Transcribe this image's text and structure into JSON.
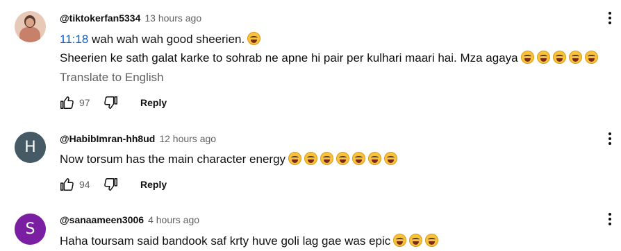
{
  "comments": [
    {
      "handle": "@tiktokerfan5334",
      "time": "13 hours ago",
      "timestamp_link": "11:18",
      "line1": "wah wah wah good sheerien.",
      "line1_emojis": 1,
      "line2": "Sheerien ke sath galat karke to sohrab ne apne hi pair per kulhari maari hai. Mza agaya",
      "line2_emojis": 5,
      "translate": "Translate to English",
      "likes": "97",
      "reply": "Reply",
      "avatar_type": "photo"
    },
    {
      "handle": "@HabibImran-hh8ud",
      "time": "12 hours ago",
      "line1": "Now torsum has the main character energy",
      "line1_emojis": 7,
      "likes": "94",
      "reply": "Reply",
      "avatar_letter": "H",
      "avatar_color": "#455a64"
    },
    {
      "handle": "@sanaameen3006",
      "time": "4 hours ago",
      "line1": "Haha toursam said bandook saf krty huve goli lag gae was epic",
      "line1_emojis": 3,
      "avatar_letter": "S",
      "avatar_color": "#7b1fa2"
    }
  ],
  "icons": {
    "like": "thumbs-up-icon",
    "dislike": "thumbs-down-icon",
    "menu": "more-vert-icon",
    "emoji": "tears-of-joy-emoji"
  }
}
